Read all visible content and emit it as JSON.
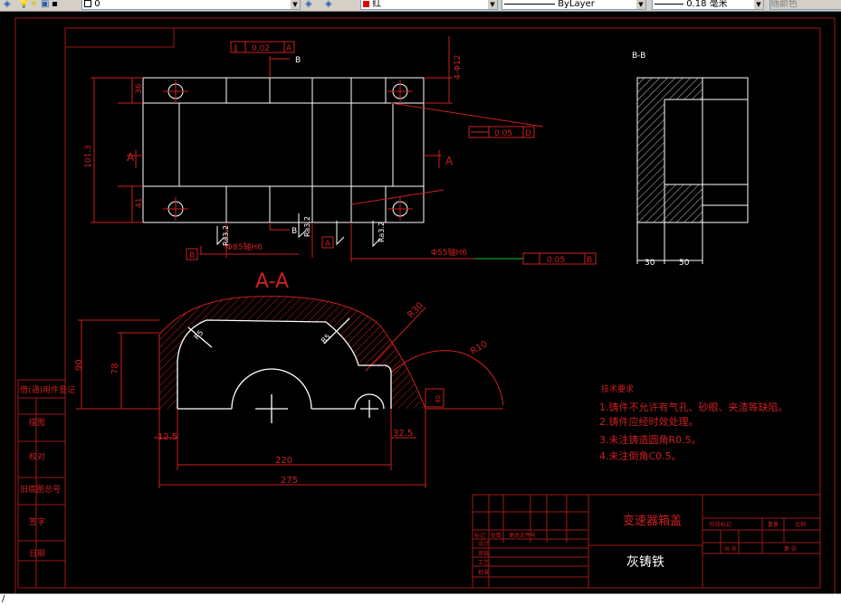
{
  "toolbar": {
    "layer_value": "0",
    "color_value": "红",
    "linetype_value": "ByLayer",
    "lineweight_value": "0.18 毫米",
    "plotstyle_value": "随颜色"
  },
  "drawing": {
    "section_bb": "B-B",
    "section_aa": "A-A",
    "view_a_left": "A",
    "view_a_right": "A",
    "view_b_top": "B",
    "view_b_bottom": "B",
    "datum_a": "A",
    "datum_b": "B",
    "tol_parallel": "0.02",
    "tol_parallel_ref": "A",
    "tol_top": "0.05",
    "tol_top_ref": "D",
    "tol_coax": "0.05",
    "tol_coax_ref": "B",
    "dim_phi12": "4-Φ12",
    "dim_101": "101.3",
    "dim_36": "36",
    "dim_41": "41",
    "dim_bore85": "Φ85轴H6",
    "dim_bore55": "Φ55轴H6",
    "rough1": "Ra3.2",
    "rough2": "Ra3.2",
    "rough3": "Ra3.2",
    "dim_30": "30",
    "dim_50": "50",
    "dim_90": "90",
    "dim_78": "78",
    "dim_r30": "R30",
    "dim_r5a": "R5",
    "dim_r5b": "R5",
    "dim_r10": "R10",
    "dim_40": "40",
    "dim_12_5": "12.5",
    "dim_32_5": "32.5",
    "dim_220": "220",
    "dim_275": "275"
  },
  "notes": {
    "title": "技术要求",
    "lines": [
      "1.铸件不允许有气孔、砂眼、夹渣等缺陷。",
      "2.铸件应经时效处理。",
      "3.未注铸造圆角R0.5。",
      "4.未注倒角C0.5。"
    ]
  },
  "side_table": {
    "rows": [
      "借(通)用件登记",
      "描图",
      "校对",
      "旧底图总号",
      "签字",
      "日期"
    ]
  },
  "title_block": {
    "part_name": "变速器箱盖",
    "material": "灰铸铁",
    "label_stage": "阶段标记",
    "label_weight": "重量",
    "label_scale": "比例",
    "label_sheet": "共 张",
    "label_sheet2": "第 张",
    "row_labels": [
      "标记",
      "处数",
      "更改文件号",
      "设计",
      "审核",
      "工艺",
      "批准"
    ]
  },
  "cmdbar": {
    "prompt": "/"
  }
}
